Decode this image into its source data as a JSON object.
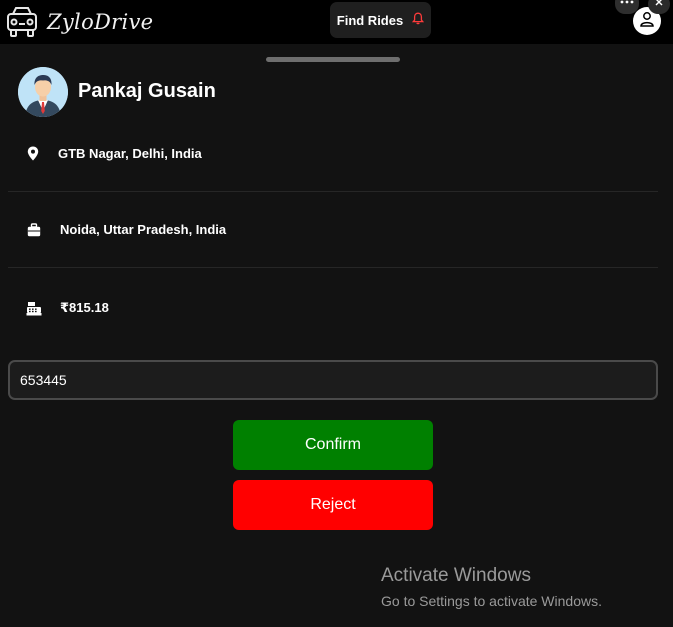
{
  "app": {
    "brand": "ZyloDrive",
    "find_rides_label": "Find Rides"
  },
  "icons": {
    "logo": "car-front-icon",
    "bell": "bell-icon",
    "more": "more-dots-icon",
    "close": "close-icon",
    "profile": "user-icon",
    "pickup": "location-pin-icon",
    "drop": "briefcase-icon",
    "fare": "cash-register-icon"
  },
  "colors": {
    "bell": "#ff3b3b",
    "confirm": "#008000",
    "reject": "#ff0000",
    "background": "#121212"
  },
  "rider": {
    "name": "Pankaj Gusain"
  },
  "ride": {
    "pickup": "GTB Nagar, Delhi, India",
    "drop": "Noida, Uttar Pradesh, India",
    "fare": "₹815.18"
  },
  "otp": {
    "value": "653445"
  },
  "actions": {
    "confirm_label": "Confirm",
    "reject_label": "Reject"
  },
  "watermark": {
    "title": "Activate Windows",
    "subtitle": "Go to Settings to activate Windows."
  }
}
